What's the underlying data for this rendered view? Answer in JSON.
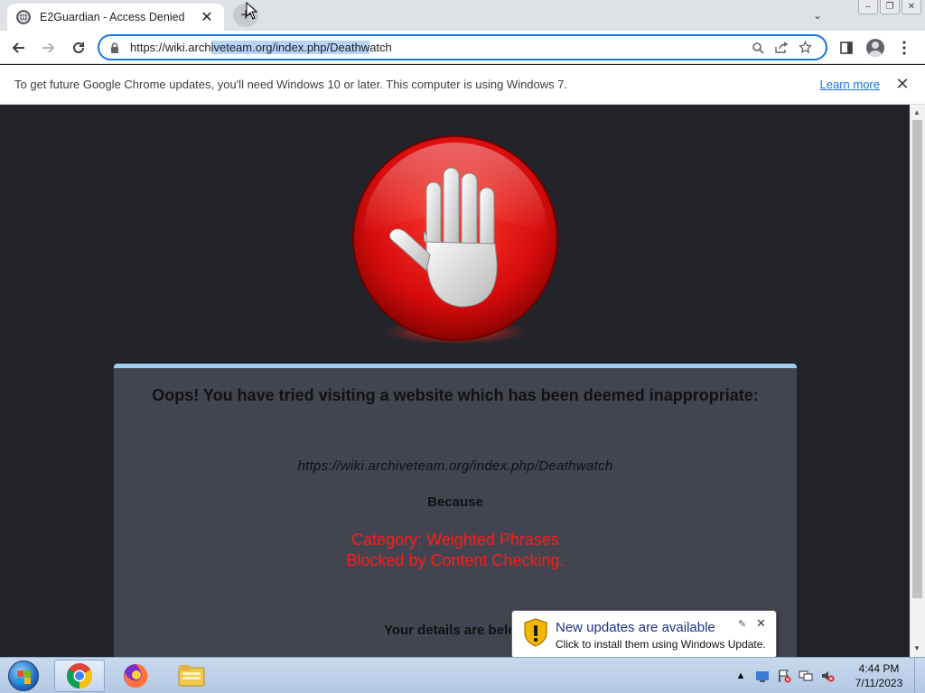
{
  "browser": {
    "tab": {
      "title": "E2Guardian - Access Denied",
      "close_glyph": "✕"
    },
    "new_tab_glyph": "+",
    "tab_search_glyph": "⌄",
    "window_buttons": [
      "–",
      "❐",
      "✕"
    ],
    "address": {
      "url_prefix": "https://wiki.arch",
      "url_selected": "iveteam.org/index.php/Deathw",
      "url_suffix": "atch"
    }
  },
  "infobar": {
    "message": "To get future Google Chrome updates, you'll need Windows 10 or later. This computer is using Windows 7.",
    "learn_more": "Learn more",
    "close_glyph": "✕"
  },
  "page": {
    "heading": "Oops! You have tried visiting a website which has been deemed inappropriate:",
    "blocked_url": "https://wiki.archiveteam.org/index.php/Deathwatch",
    "because": "Because",
    "category": "Category: Weighted Phrases",
    "blocked_by": "Blocked by Content Checking.",
    "details": "Your details are below"
  },
  "notification": {
    "title": "New updates are available",
    "body": "Click to install them using Windows Update.",
    "close_glyph": "✕"
  },
  "taskbar": {
    "time": "4:44 PM",
    "date": "7/11/2023",
    "tray_arrow": "▲"
  },
  "colors": {
    "accent": "#1a73e8",
    "panel_background": "#42454f",
    "panel_border": "#9fd0f2",
    "reason_text": "#ff1a1a",
    "page_background": "#232429"
  }
}
